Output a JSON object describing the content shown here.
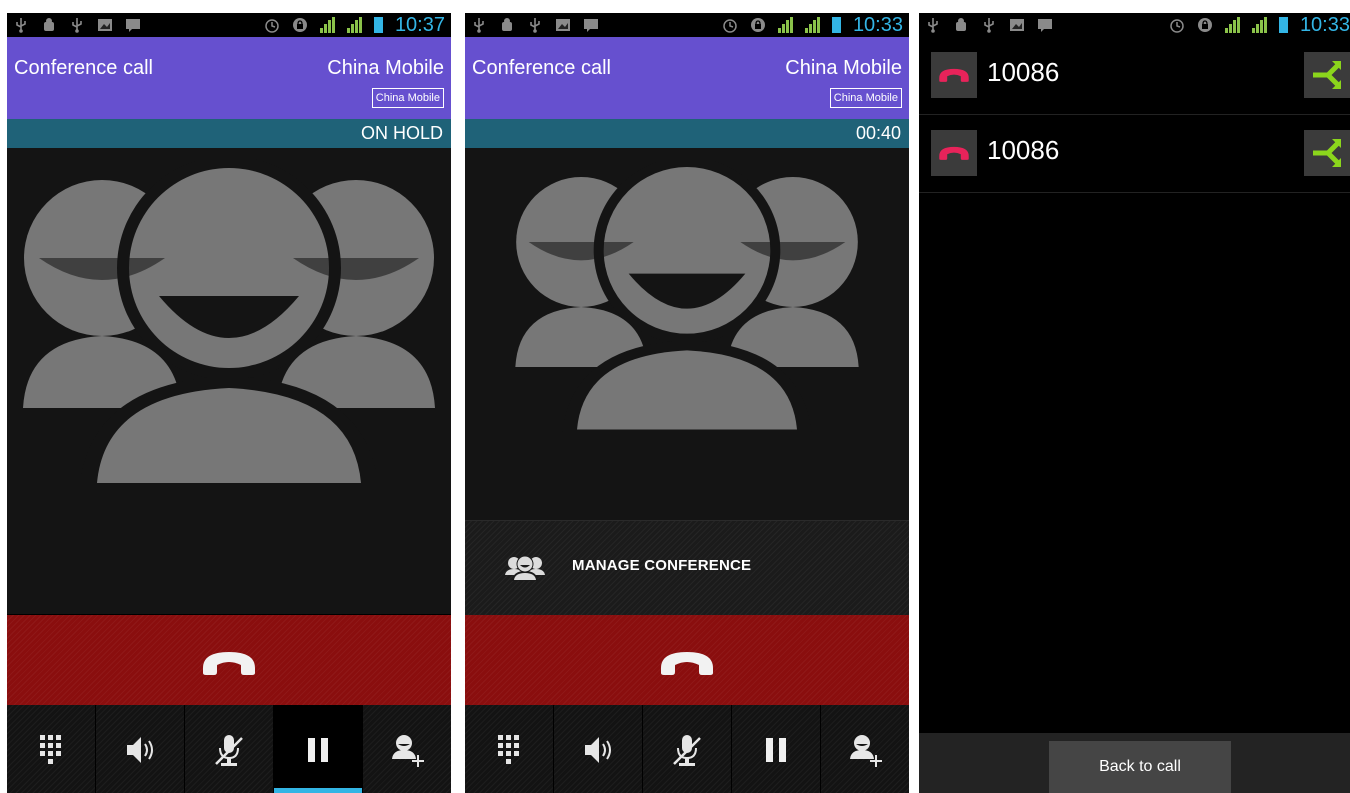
{
  "colors": {
    "header": "#6650cf",
    "state_bar": "#1f6278",
    "end_call": "#8a0e0e",
    "accent": "#33b5e5",
    "hangup_pink": "#e8235a",
    "split_green": "#8bd61c"
  },
  "status_bar_icons": [
    "usb-icon",
    "android-debug-icon",
    "usb-icon",
    "picture-icon",
    "notification-icon"
  ],
  "screens": [
    {
      "status_time": "10:37",
      "header": {
        "title": "Conference call",
        "carrier": "China Mobile",
        "carrier_badge": "China Mobile"
      },
      "call_state": "ON HOLD",
      "controls": [
        "dialpad-icon",
        "speaker-icon",
        "mute-icon",
        "hold-icon",
        "add-call-icon"
      ],
      "active_control": "hold"
    },
    {
      "status_time": "10:33",
      "header": {
        "title": "Conference call",
        "carrier": "China Mobile",
        "carrier_badge": "China Mobile"
      },
      "call_state": "00:40",
      "manage_conference_label": "MANAGE CONFERENCE",
      "controls": [
        "dialpad-icon",
        "speaker-icon",
        "mute-icon",
        "hold-icon",
        "add-call-icon"
      ]
    },
    {
      "status_time": "10:33",
      "participants": [
        {
          "number": "10086"
        },
        {
          "number": "10086"
        }
      ],
      "back_button_label": "Back to call"
    }
  ]
}
